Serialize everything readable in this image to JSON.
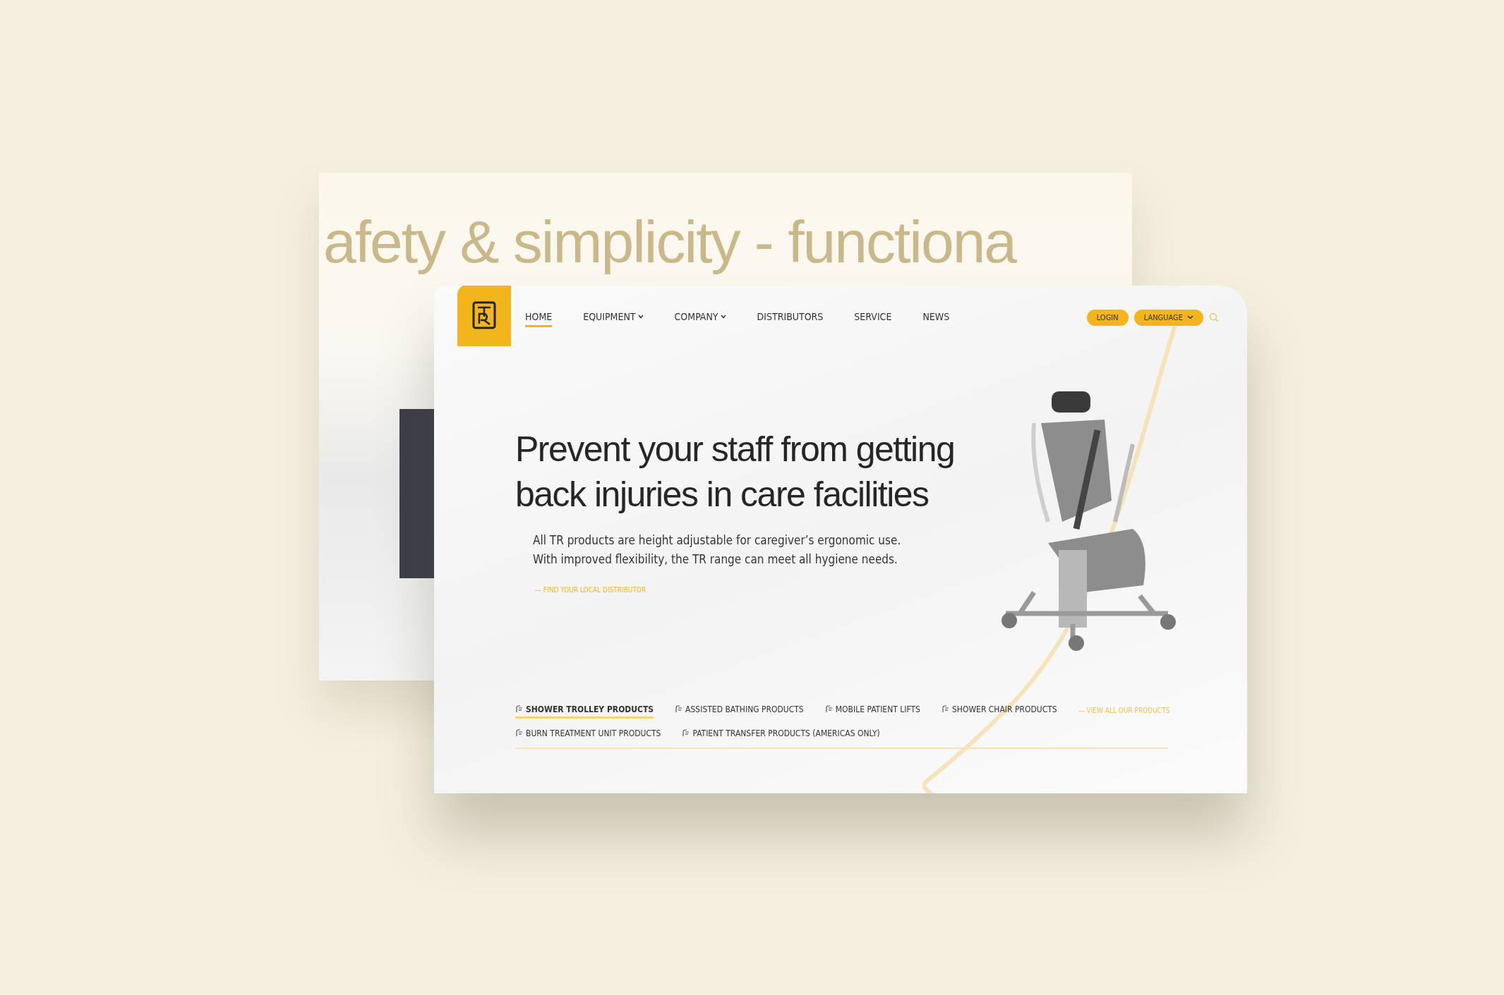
{
  "backdrop": {
    "tagline": "afety & simplicity - functiona"
  },
  "nav": {
    "items": [
      {
        "label": "HOME",
        "selected": true,
        "dropdown": false
      },
      {
        "label": "EQUIPMENT",
        "selected": false,
        "dropdown": true
      },
      {
        "label": "COMPANY",
        "selected": false,
        "dropdown": true
      },
      {
        "label": "DISTRIBUTORS",
        "selected": false,
        "dropdown": false
      },
      {
        "label": "SERVICE",
        "selected": false,
        "dropdown": false
      },
      {
        "label": "NEWS",
        "selected": false,
        "dropdown": false
      }
    ],
    "login": "LOGIN",
    "language": "LANGUAGE"
  },
  "hero": {
    "title_lines": [
      "Prevent your staff from getting",
      "back injuries in care facilities"
    ],
    "text_lines": [
      "All TR products are height adjustable for caregiver’s ergonomic use.",
      "With improved flexibility, the TR range can meet all hygiene needs."
    ],
    "link": "— FIND YOUR LOCAL DISTRIBUTOR"
  },
  "categories": [
    {
      "label": "SHOWER TROLLEY PRODUCTS",
      "selected": true
    },
    {
      "label": "ASSISTED BATHING PRODUCTS",
      "selected": false
    },
    {
      "label": "MOBILE PATIENT LIFTS",
      "selected": false
    },
    {
      "label": "SHOWER CHAIR PRODUCTS",
      "selected": false
    },
    {
      "label": "BURN TREATMENT UNIT PRODUCTS",
      "selected": false
    },
    {
      "label": "PATIENT TRANSFER PRODUCTS (AMERICAS ONLY)",
      "selected": false
    }
  ],
  "view_all": "— VIEW ALL OUR PRODUCTS"
}
